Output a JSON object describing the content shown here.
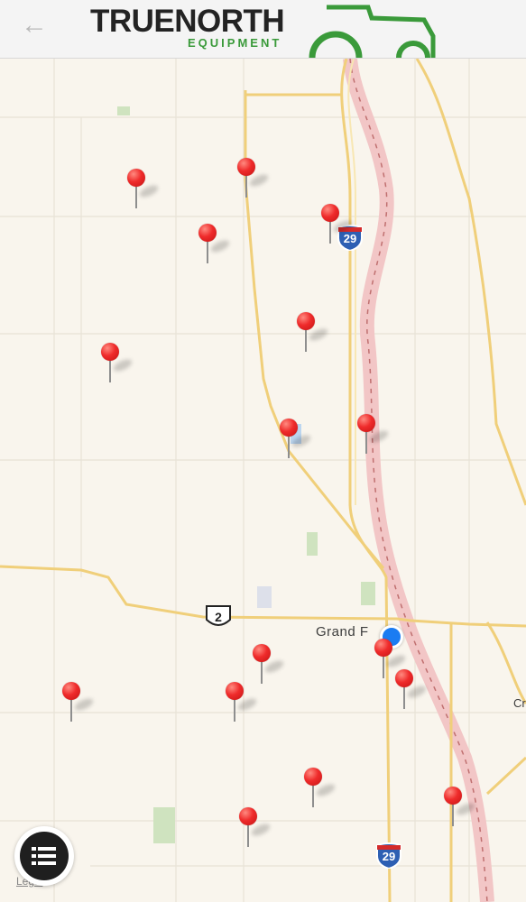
{
  "header": {
    "back_icon": "back-arrow-icon",
    "brand_name": "TRUENORTH",
    "brand_sub": "EQUIPMENT",
    "brand_color": "#3a9a3a"
  },
  "map": {
    "highway_29_label": "29",
    "us_route_label": "2",
    "city_label": "Grand F",
    "edge_label": "Cr",
    "legal_label": "Legal",
    "pin_color": "#e82525",
    "location_color": "#1b7cf2",
    "pin_count": 17
  },
  "controls": {
    "list_button_icon": "list-icon"
  }
}
